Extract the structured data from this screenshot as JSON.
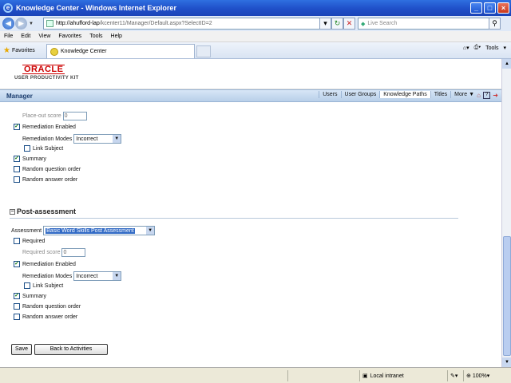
{
  "window": {
    "title": "Knowledge Center - Windows Internet Explorer"
  },
  "address": {
    "url_host": "http://ahufford-lap",
    "url_rest": "/kcenter11/Manager/Default.aspx?SelectID=2",
    "search_placeholder": "Live Search"
  },
  "menu": [
    "File",
    "Edit",
    "View",
    "Favorites",
    "Tools",
    "Help"
  ],
  "favbar": {
    "favorites_label": "Favorites",
    "tab_label": "Knowledge Center",
    "tools_label": "Tools"
  },
  "header": {
    "logo": "ORACLE",
    "subtitle": "USER PRODUCTIVITY KIT"
  },
  "manager": {
    "title": "Manager",
    "tabs": [
      "Users",
      "User Groups",
      "Knowledge Paths",
      "Titles",
      "More ▼"
    ],
    "active_tab": "Knowledge Paths"
  },
  "pre": {
    "placeout_label": "Place-out score",
    "placeout_value": "0",
    "remediation_label": "Remediation Enabled",
    "modes_label": "Remediation Modes",
    "modes_value": "Incorrect",
    "link_subject": "Link Subject",
    "summary": "Summary",
    "random_q": "Random question order",
    "random_a": "Random answer order"
  },
  "post": {
    "section_title": "Post-assessment",
    "assessment_label": "Assessment",
    "assessment_value": "Basic Word Skills Post Assessment",
    "required": "Required",
    "required_score_label": "Required score",
    "required_score_value": "0",
    "remediation_label": "Remediation Enabled",
    "modes_label": "Remediation Modes",
    "modes_value": "Incorrect",
    "link_subject": "Link Subject",
    "summary": "Summary",
    "random_q": "Random question order",
    "random_a": "Random answer order"
  },
  "buttons": {
    "save": "Save",
    "back": "Back to Activities"
  },
  "status": {
    "zone": "Local intranet",
    "zoom": "100%"
  }
}
